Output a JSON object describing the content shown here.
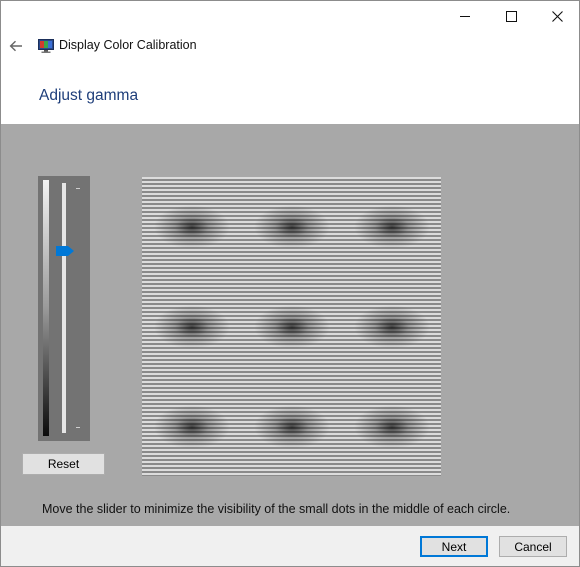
{
  "window": {
    "app_title": "Display Color Calibration",
    "caption_buttons": {
      "minimize": "minimize-icon",
      "maximize": "maximize-icon",
      "close": "close-icon"
    },
    "back_icon": "back-arrow-icon",
    "app_icon": "display-color-calibration-icon"
  },
  "page": {
    "title": "Adjust gamma",
    "instruction": "Move the slider to minimize the visibility of the small dots in the middle of each circle."
  },
  "gamma_slider": {
    "level": 0.27,
    "reset_label": "Reset"
  },
  "colors": {
    "accent": "#0078d7",
    "title_text": "#1e3e7a",
    "content_bg": "#a8a8a8"
  },
  "footer": {
    "next_label": "Next",
    "cancel_label": "Cancel"
  }
}
